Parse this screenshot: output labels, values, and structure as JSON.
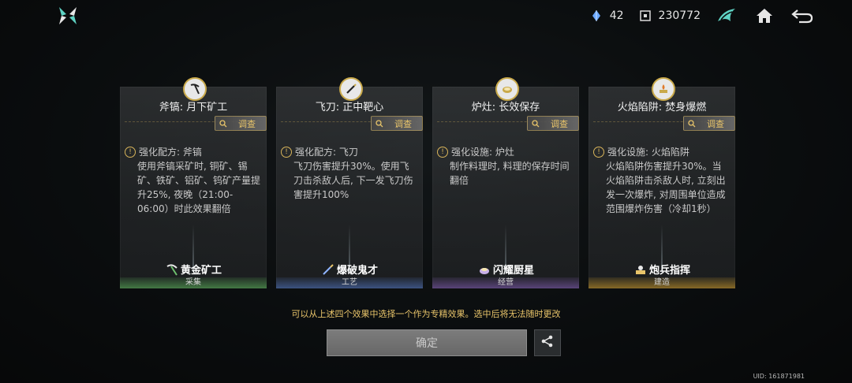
{
  "topbar": {
    "logo_icon": "game-logo-icon",
    "resource_1": {
      "icon": "blue-crystal-icon",
      "value": "42"
    },
    "resource_2": {
      "icon": "puzzle-token-icon",
      "value": "230772"
    }
  },
  "cards": [
    {
      "title": "斧镐: 月下矿工",
      "inspect_label": "调查",
      "effect_head": "强化配方: 斧镐",
      "effect_desc": "使用斧镐采矿时, 铜矿、锡矿、铁矿、铝矿、钨矿产量提升25%, 夜晚（21:00-06:00）时此效果翻倍",
      "rank_label": "黄金矿工",
      "category": "采集"
    },
    {
      "title": "飞刀: 正中靶心",
      "inspect_label": "调查",
      "effect_head": "强化配方: 飞刀",
      "effect_desc": "飞刀伤害提升30%。使用飞刀击杀敌人后, 下一发飞刀伤害提升100%",
      "rank_label": "爆破鬼才",
      "category": "工艺"
    },
    {
      "title": "炉灶: 长效保存",
      "inspect_label": "调查",
      "effect_head": "强化设施: 炉灶",
      "effect_desc": "制作料理时, 料理的保存时间翻倍",
      "rank_label": "闪耀厨星",
      "category": "经营"
    },
    {
      "title": "火焰陷阱: 焚身爆燃",
      "inspect_label": "调查",
      "effect_head": "强化设施: 火焰陷阱",
      "effect_desc": "火焰陷阱伤害提升30%。当火焰陷阱击杀敌人时, 立刻出发一次爆炸, 对周围单位造成范围爆炸伤害（冷却1秒）",
      "rank_label": "炮兵指挥",
      "category": "建造"
    }
  ],
  "notice": "可以从上述四个效果中选择一个作为专精效果。选中后将无法随时更改",
  "confirm_label": "确定",
  "uid": "UID: 161871981",
  "colors": {
    "accent_gold": "#e8c46a",
    "text": "#d9d9d9"
  }
}
